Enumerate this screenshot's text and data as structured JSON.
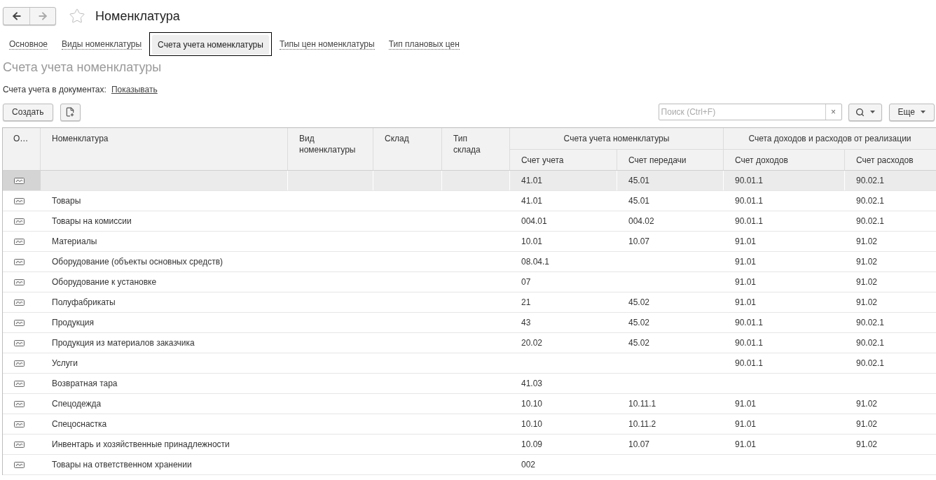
{
  "nav": {
    "title": "Номенклатура",
    "favorite": false
  },
  "tabs": [
    {
      "label": "Основное",
      "selected": false
    },
    {
      "label": "Виды номенклатуры",
      "selected": false
    },
    {
      "label": "Счета учета номенклатуры",
      "selected": true
    },
    {
      "label": "Типы цен номенклатуры",
      "selected": false
    },
    {
      "label": "Тип плановых цен",
      "selected": false
    }
  ],
  "section_title": "Счета учета номенклатуры",
  "docs_setting": {
    "label": "Счета учета в документах:",
    "link": "Показывать"
  },
  "toolbar": {
    "create_button": "Создать",
    "search": {
      "placeholder": "Поиск (Ctrl+F)",
      "clear": "×"
    },
    "more_button": "Еще"
  },
  "table": {
    "columns": [
      "О…",
      "Номенклатура",
      "Вид номенклатуры",
      "Склад",
      "Тип склада"
    ],
    "column_groups": [
      {
        "label": "Счета учета номенклатуры",
        "columns": [
          "Счет учета",
          "Счет передачи"
        ]
      },
      {
        "label": "Счета доходов и расходов от реализации",
        "columns": [
          "Счет доходов",
          "Счет расходов"
        ]
      }
    ],
    "rows": [
      {
        "selected": true,
        "account": "41.01",
        "transfer_account": "45.01",
        "income_account": "90.01.1",
        "expense_account": "90.02.1"
      },
      {
        "selected": false,
        "nomenclature": "Товары",
        "account": "41.01",
        "transfer_account": "45.01",
        "income_account": "90.01.1",
        "expense_account": "90.02.1"
      },
      {
        "selected": false,
        "nomenclature": "Товары на комиссии",
        "account": "004.01",
        "transfer_account": "004.02",
        "income_account": "90.01.1",
        "expense_account": "90.02.1"
      },
      {
        "selected": false,
        "nomenclature": "Материалы",
        "account": "10.01",
        "transfer_account": "10.07",
        "income_account": "91.01",
        "expense_account": "91.02"
      },
      {
        "selected": false,
        "nomenclature": "Оборудование (объекты основных средств)",
        "account": "08.04.1",
        "income_account": "91.01",
        "expense_account": "91.02"
      },
      {
        "selected": false,
        "nomenclature": "Оборудование к установке",
        "account": "07",
        "income_account": "91.01",
        "expense_account": "91.02"
      },
      {
        "selected": false,
        "nomenclature": "Полуфабрикаты",
        "account": "21",
        "transfer_account": "45.02",
        "income_account": "91.01",
        "expense_account": "91.02"
      },
      {
        "selected": false,
        "nomenclature": "Продукция",
        "account": "43",
        "transfer_account": "45.02",
        "income_account": "90.01.1",
        "expense_account": "90.02.1"
      },
      {
        "selected": false,
        "nomenclature": "Продукция из материалов заказчика",
        "account": "20.02",
        "transfer_account": "45.02",
        "income_account": "90.01.1",
        "expense_account": "90.02.1"
      },
      {
        "selected": false,
        "nomenclature": "Услуги",
        "income_account": "90.01.1",
        "expense_account": "90.02.1"
      },
      {
        "selected": false,
        "nomenclature": "Возвратная тара",
        "account": "41.03"
      },
      {
        "selected": false,
        "nomenclature": "Спецодежда",
        "account": "10.10",
        "transfer_account": "10.11.1",
        "income_account": "91.01",
        "expense_account": "91.02"
      },
      {
        "selected": false,
        "nomenclature": "Спецоснастка",
        "account": "10.10",
        "transfer_account": "10.11.2",
        "income_account": "91.01",
        "expense_account": "91.02"
      },
      {
        "selected": false,
        "nomenclature": "Инвентарь и хозяйственные принадлежности",
        "account": "10.09",
        "transfer_account": "10.07",
        "income_account": "91.01",
        "expense_account": "91.02"
      },
      {
        "selected": false,
        "nomenclature": "Товары на ответственном хранении",
        "account": "002"
      }
    ]
  }
}
